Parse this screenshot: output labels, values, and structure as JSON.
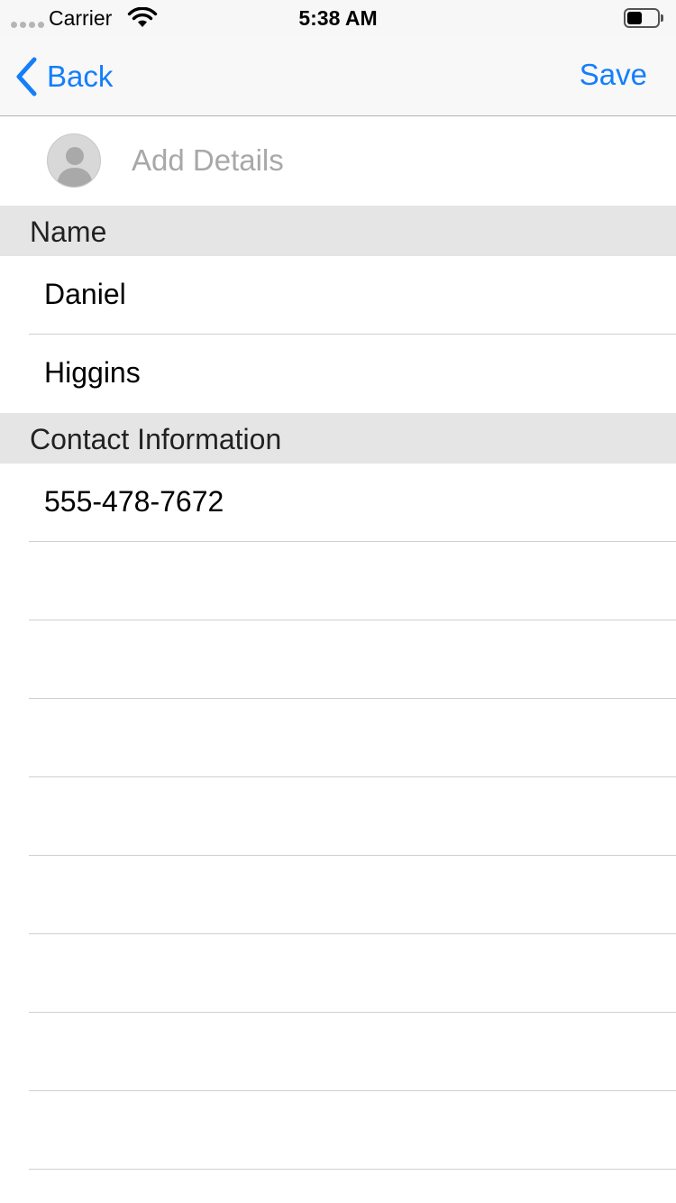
{
  "status_bar": {
    "carrier": "Carrier",
    "time": "5:38 AM"
  },
  "nav": {
    "back_label": "Back",
    "save_label": "Save",
    "accent_color": "#147efb"
  },
  "header": {
    "add_details_label": "Add Details"
  },
  "sections": {
    "name_title": "Name",
    "contact_title": "Contact Information"
  },
  "fields": {
    "first_name": "Daniel",
    "last_name": "Higgins",
    "phone": "555-478-7672"
  }
}
